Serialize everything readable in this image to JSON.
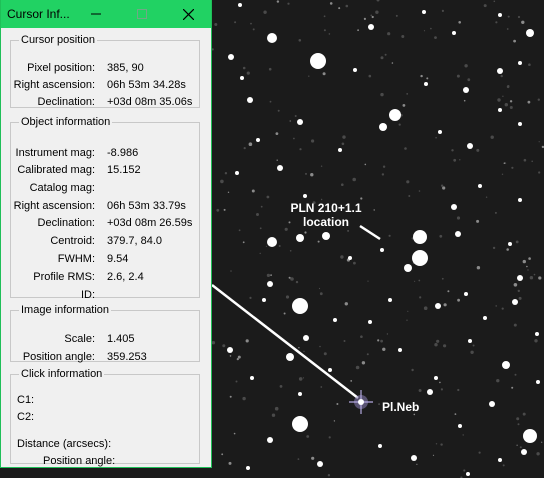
{
  "window": {
    "title": "Cursor Inf..."
  },
  "cursor_position": {
    "legend": "Cursor position",
    "rows": [
      {
        "label": "Pixel position:",
        "value": "385, 90"
      },
      {
        "label": "Right ascension:",
        "value": "06h 53m 34.28s"
      },
      {
        "label": "Declination:",
        "value": "+03d 08m 35.06s"
      }
    ]
  },
  "object_information": {
    "legend": "Object information",
    "rows": [
      {
        "label": "Instrument mag:",
        "value": "-8.986"
      },
      {
        "label": "Calibrated mag:",
        "value": "15.152"
      },
      {
        "label": "Catalog mag:",
        "value": ""
      },
      {
        "label": "Right ascension:",
        "value": "06h 53m 33.79s"
      },
      {
        "label": "Declination:",
        "value": "+03d 08m 26.59s"
      },
      {
        "label": "Centroid:",
        "value": "379.7, 84.0"
      },
      {
        "label": "FWHM:",
        "value": "9.54"
      },
      {
        "label": "Profile RMS:",
        "value": "2.6, 2.4"
      },
      {
        "label": "ID:",
        "value": ""
      }
    ]
  },
  "image_information": {
    "legend": "Image information",
    "rows": [
      {
        "label": "Scale:",
        "value": "1.405"
      },
      {
        "label": "Position angle:",
        "value": "359.253"
      }
    ]
  },
  "click_information": {
    "legend": "Click information",
    "c1_label": "C1:",
    "c2_label": "C2:",
    "distance_label": "Distance (arcsecs):",
    "pa_label": "Position angle:"
  },
  "annotations": {
    "pln_line1": "PLN 210+1.1",
    "pln_line2": "location",
    "plneb": "Pl.Neb"
  },
  "colors": {
    "titlebar": "#21d263",
    "sky": "#1a1a1a"
  }
}
